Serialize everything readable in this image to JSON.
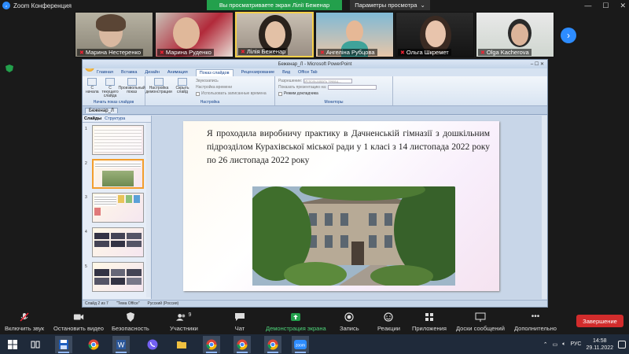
{
  "zoom": {
    "window_title": "Zoom Конференция",
    "share_banner": "Вы просматриваете экран Лілії Беженар",
    "view_options": "Параметры просмотра",
    "participants": [
      {
        "name": "Марина Нестеренко",
        "muted": true
      },
      {
        "name": "Марина Руденко",
        "muted": true
      },
      {
        "name": "Лілія Беженар",
        "muted": true,
        "active": true
      },
      {
        "name": "Ангеліна Рубцова",
        "muted": true
      },
      {
        "name": "Ольга Шкремет",
        "muted": true
      },
      {
        "name": "Olga Kacherova",
        "muted": true
      }
    ],
    "controls": {
      "audio": "Включить звук",
      "video": "Остановить видео",
      "security": "Безопасность",
      "participants": "Участники",
      "participants_count": "9",
      "chat": "Чат",
      "share": "Демонстрация экрана",
      "record": "Запись",
      "reactions": "Реакции",
      "apps": "Приложения",
      "whiteboard": "Доски сообщений",
      "more": "Дополнительно",
      "end": "Завершение"
    },
    "colors": {
      "share_green": "#23a04c",
      "end_red": "#d22c2c",
      "accent_blue": "#2d8cff"
    }
  },
  "ppt": {
    "window_title": "Беженар_Л - Microsoft PowerPoint",
    "tabs": [
      "Главная",
      "Вставка",
      "Дизайн",
      "Анимация",
      "Показ слайдов",
      "Рецензирование",
      "Вид",
      "Office Tab"
    ],
    "active_tab": "Показ слайдов",
    "ribbon": {
      "group1_label": "Начать показ слайдов",
      "btn_start": "С начала",
      "btn_current": "С текущего слайда",
      "btn_custom": "Произвольный показ",
      "group2_label": "Настройка",
      "btn_setup": "Настройка демонстрации",
      "btn_hide": "Скрыть слайд",
      "opt_record": "Звукозапись",
      "opt_rehearse": "Настройка времени",
      "opt_use_timings": "Использовать записанные времена",
      "group3_label": "Мониторы",
      "opt_resolution": "Разрешение:",
      "resolution_value": "Использовать текущ...",
      "opt_show_on": "Показать презентацию на:",
      "opt_presenter": "Режим докладчика"
    },
    "doc_tab": "Беженар_Л",
    "thumb_tabs": [
      "Слайды",
      "Структура"
    ],
    "slide_numbers": [
      "1",
      "2",
      "3",
      "4",
      "5"
    ],
    "slide_text": "Я проходила виробничу практику в Дачненській гімназії з дошкільним підрозділом Курахівської міської ради у 1 класі з 14 листопада 2022 року по 26 листопада 2022 року",
    "status": {
      "slide": "Слайд 2 из 7",
      "theme": "\"Тема Office\"",
      "language": "Русский (Россия)"
    }
  },
  "taskbar": {
    "time": "14:58",
    "date": "29.11.2022",
    "lang": "РУС"
  }
}
